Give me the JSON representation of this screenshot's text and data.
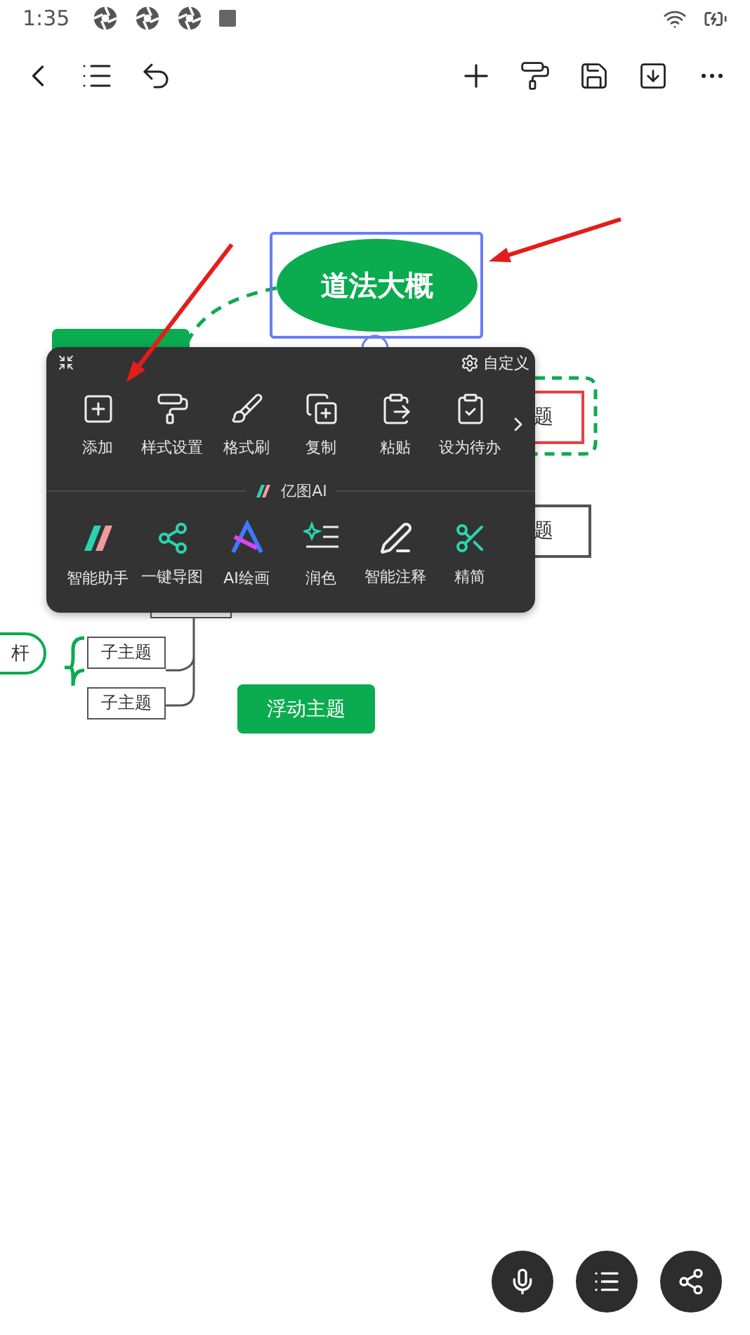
{
  "status_bar": {
    "time": "1:35"
  },
  "mind_map": {
    "central_topic": "道法大概",
    "partial_topics": [
      "题",
      "题"
    ],
    "left_topic": "杆",
    "subtopics": [
      "子主题",
      "子主题"
    ],
    "floating_topic": "浮动主题"
  },
  "context_menu": {
    "customize": "自定义",
    "ai_section_title": "亿图AI",
    "actions": [
      {
        "label": "添加"
      },
      {
        "label": "样式设置"
      },
      {
        "label": "格式刷"
      },
      {
        "label": "复制"
      },
      {
        "label": "粘贴"
      },
      {
        "label": "设为待办"
      }
    ],
    "ai_actions": [
      {
        "label": "智能助手"
      },
      {
        "label": "一键导图"
      },
      {
        "label": "AI绘画"
      },
      {
        "label": "润色"
      },
      {
        "label": "智能注释"
      },
      {
        "label": "精简"
      }
    ]
  }
}
